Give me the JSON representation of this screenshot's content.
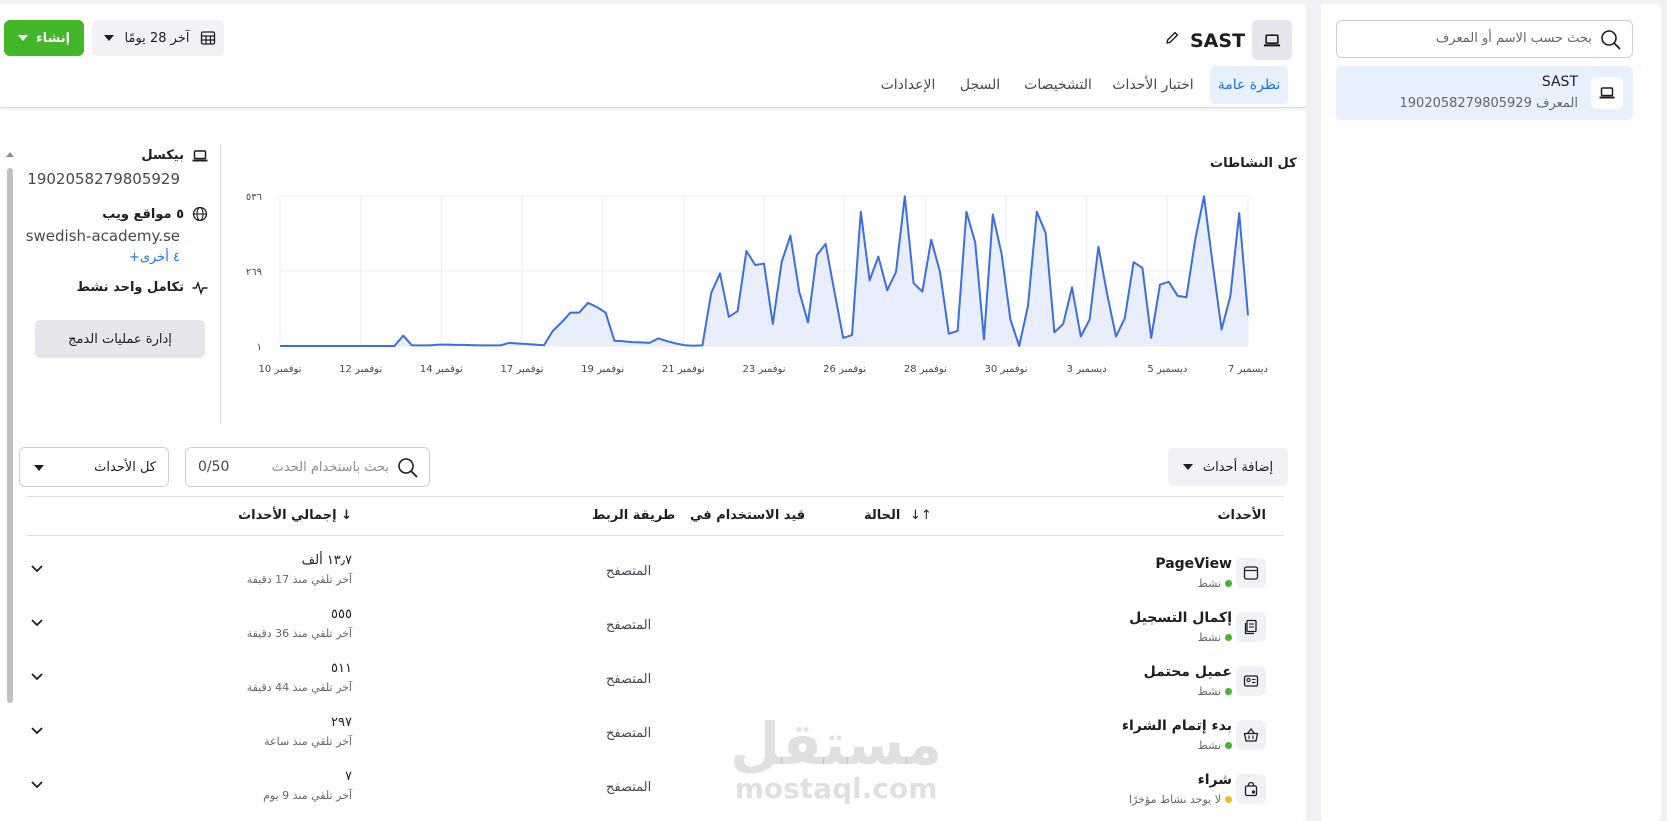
{
  "sidebar": {
    "search_placeholder": "بحث حسب الاسم أو المعرف",
    "dataset": {
      "name": "SAST",
      "id_label": "المعرف 1902058279805929"
    }
  },
  "header": {
    "title": "SAST",
    "create_label": "إنشاء",
    "date_range_label": "آخر 28 يومًا",
    "tabs": [
      "نظرة عامة",
      "اختبار الأحداث",
      "التشخيصات",
      "السجل",
      "الإعدادات"
    ]
  },
  "info": {
    "pixel_label": "بيكسل",
    "pixel_id": "1902058279805929",
    "websites_label": "٥ مواقع ويب",
    "website": "swedish-academy.se",
    "more_link": "+٤ أخرى",
    "integration_label": "تكامل واحد نشط",
    "manage_button": "إدارة عمليات الدمج"
  },
  "chart_data": {
    "type": "area",
    "title": "كل النشاطات",
    "ytick_labels": [
      "١",
      "٢٦٩",
      "٥٣٦"
    ],
    "yticks": [
      1,
      269,
      536
    ],
    "ylim": [
      1,
      536
    ],
    "xtick_labels": [
      "نوفمبر 10",
      "نوفمبر 12",
      "نوفمبر 14",
      "نوفمبر 17",
      "نوفمبر 19",
      "نوفمبر 21",
      "نوفمبر 23",
      "نوفمبر 26",
      "نوفمبر 28",
      "نوفمبر 30",
      "ديسمبر 3",
      "ديسمبر 5",
      "ديسمبر 7"
    ],
    "x_start": "نوفمبر 10",
    "x_end": "ديسمبر 8",
    "values": [
      1,
      1,
      1,
      1,
      1,
      1,
      1,
      1,
      1,
      1,
      1,
      1,
      1,
      1,
      38,
      3,
      3,
      3,
      6,
      6,
      5,
      5,
      4,
      3,
      3,
      3,
      12,
      10,
      8,
      6,
      4,
      55,
      85,
      120,
      120,
      155,
      140,
      120,
      20,
      18,
      15,
      14,
      12,
      28,
      18,
      10,
      4,
      2,
      3,
      190,
      260,
      105,
      125,
      340,
      290,
      295,
      80,
      300,
      395,
      195,
      85,
      325,
      365,
      195,
      30,
      40,
      480,
      235,
      320,
      200,
      265,
      535,
      225,
      195,
      380,
      265,
      45,
      55,
      480,
      370,
      25,
      470,
      330,
      95,
      1,
      145,
      480,
      405,
      50,
      80,
      210,
      35,
      95,
      355,
      185,
      35,
      100,
      300,
      280,
      30,
      220,
      230,
      180,
      175,
      380,
      535,
      290,
      60,
      180,
      475,
      110
    ]
  },
  "events_toolbar": {
    "add_events_label": "إضافة أحداث",
    "search_placeholder": "بحث باستخدام الحدث",
    "search_count": "0/50",
    "filter_label": "كل الأحداث"
  },
  "table": {
    "headers": {
      "events": "الأحداث",
      "sort_icon": "↓↑",
      "status": "الحالة",
      "used_in": "قيد الاستخدام في",
      "connection": "طريقة الربط",
      "total": "إجمالي الأحداث ↓"
    },
    "rows": [
      {
        "name": "PageView",
        "status": "نشط",
        "status_color": "#42b72a",
        "method": "المتصفح",
        "total": "١٣٫٧ ألف",
        "last": "آخر تلقي منذ 17 دقيقة",
        "icon": "browser-window-icon"
      },
      {
        "name": "إكمال التسجيل",
        "status": "نشط",
        "status_color": "#42b72a",
        "method": "المتصفح",
        "total": "٥٥٥",
        "last": "آخر تلقي منذ 36 دقيقة",
        "icon": "registration-icon"
      },
      {
        "name": "عميل محتمل",
        "status": "نشط",
        "status_color": "#42b72a",
        "method": "المتصفح",
        "total": "٥١١",
        "last": "آخر تلقي منذ 44 دقيقة",
        "icon": "contact-card-icon"
      },
      {
        "name": "بدء إتمام الشراء",
        "status": "نشط",
        "status_color": "#42b72a",
        "method": "المتصفح",
        "total": "٢٩٧",
        "last": "آخر تلقي منذ ساعة",
        "icon": "basket-icon"
      },
      {
        "name": "شراء",
        "status": "لا يوجد نشاط مؤخرًا",
        "status_color": "#f7b928",
        "method": "المتصفح",
        "total": "٧",
        "last": "آخر تلقي منذ 9 يوم",
        "icon": "shopping-bag-icon"
      }
    ]
  },
  "watermark": {
    "arabic": "مستقل",
    "latin": "mostaql.com"
  },
  "colors": {
    "accent": "#1b74e4",
    "create": "#42b72a",
    "line": "#3b6fe0",
    "fill": "#e8eefb"
  }
}
